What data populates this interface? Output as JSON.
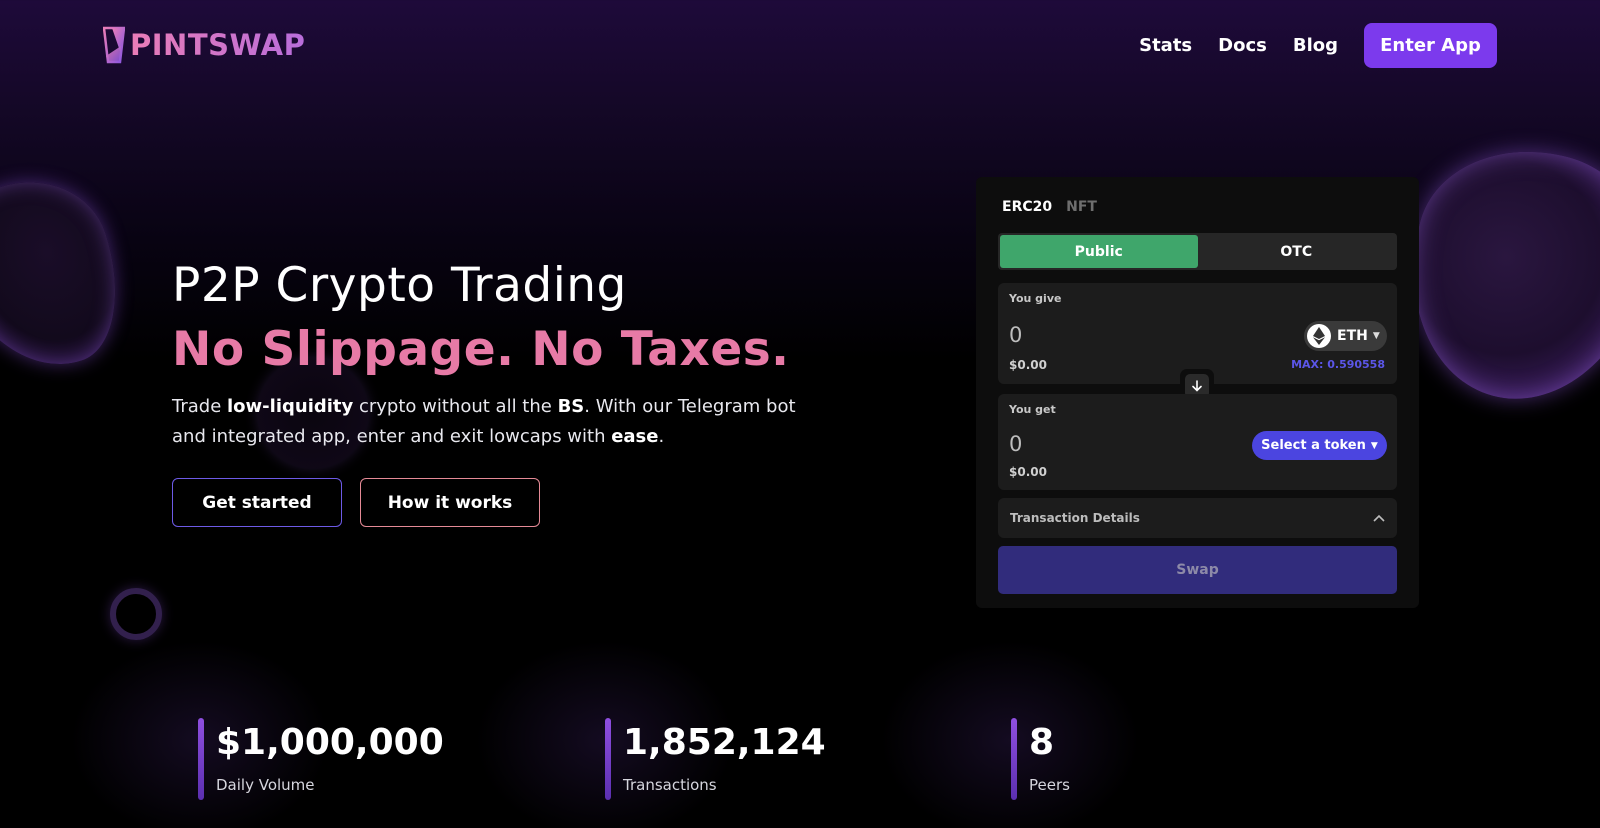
{
  "header": {
    "logo_text": "PINTSWAP",
    "nav": [
      {
        "label": "Stats"
      },
      {
        "label": "Docs"
      },
      {
        "label": "Blog"
      }
    ],
    "enter_app": "Enter App"
  },
  "hero": {
    "title": "P2P Crypto Trading",
    "subtitle": "No Slippage. No Taxes.",
    "desc": {
      "p1": "Trade ",
      "b1": "low-liquidity",
      "p2": " crypto without all the ",
      "b2": "BS",
      "p3": ". With our Telegram bot and integrated app, enter and exit lowcaps with ",
      "b3": "ease",
      "p4": "."
    },
    "get_started": "Get started",
    "how_it_works": "How it works"
  },
  "swap": {
    "tabs": [
      "ERC20",
      "NFT"
    ],
    "modes": [
      "Public",
      "OTC"
    ],
    "give": {
      "label": "You give",
      "amount": "0",
      "usd": "$0.00",
      "token": "ETH",
      "max": "MAX: 0.590558"
    },
    "get": {
      "label": "You get",
      "amount": "0",
      "usd": "$0.00",
      "select": "Select a token"
    },
    "details": "Transaction Details",
    "swap_button": "Swap"
  },
  "stats": [
    {
      "value": "$1,000,000",
      "label": "Daily Volume"
    },
    {
      "value": "1,852,124",
      "label": "Transactions"
    },
    {
      "value": "8",
      "label": "Peers"
    }
  ],
  "colors": {
    "accent_purple": "#7c3aed",
    "pink": "#e77aa6",
    "green": "#3fa66b",
    "select_blue": "#4b45e0",
    "swap_disabled": "#312c7c"
  },
  "icons": [
    "logo-pint-icon",
    "eth-icon",
    "chevron-down-icon",
    "arrow-down-icon",
    "chevron-up-icon"
  ]
}
